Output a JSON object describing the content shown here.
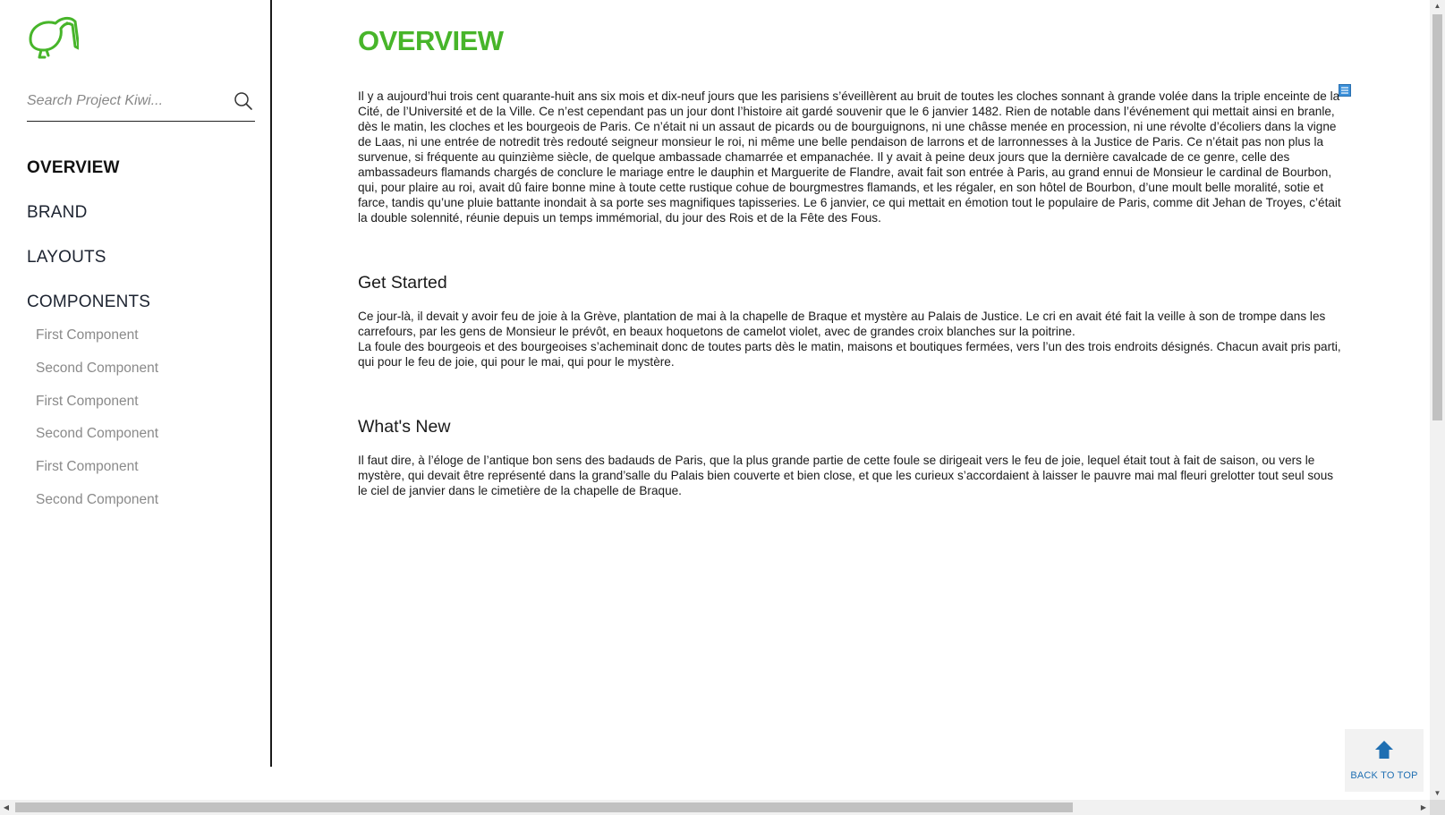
{
  "search": {
    "placeholder": "Search Project Kiwi..."
  },
  "nav": {
    "main": [
      {
        "label": "OVERVIEW",
        "active": true
      },
      {
        "label": "BRAND",
        "active": false
      },
      {
        "label": "LAYOUTS",
        "active": false
      },
      {
        "label": "COMPONENTS",
        "active": false
      }
    ],
    "sub": [
      {
        "label": "First Component"
      },
      {
        "label": "Second Component"
      },
      {
        "label": "First Component"
      },
      {
        "label": "Second Component"
      },
      {
        "label": "First Component"
      },
      {
        "label": "Second Component"
      }
    ]
  },
  "content": {
    "title": "OVERVIEW",
    "intro": "Il y a aujourd’hui trois cent quarante-huit ans six mois et dix-neuf jours que les parisiens s’éveillèrent au bruit de toutes les cloches sonnant à grande volée dans la triple enceinte de la Cité, de l’Université et de la Ville.  Ce n’est cependant pas un jour dont l’histoire ait gardé souvenir que le 6 janvier 1482. Rien de notable dans l’événement qui mettait ainsi en branle, dès le matin, les cloches et les bourgeois de Paris. Ce n’était ni un assaut de picards ou de bourguignons, ni une châsse menée en procession, ni une révolte d’écoliers dans la vigne de Laas, ni une entrée de notredit très redouté seigneur monsieur le roi, ni même une belle pendaison de larrons et de larronnesses à la Justice de Paris. Ce n’était pas non plus la survenue, si fréquente au quinzième siècle, de quelque ambassade chamarrée et empanachée. Il y avait à peine deux jours que la dernière cavalcade de ce genre, celle des ambassadeurs flamands chargés de conclure le mariage entre le dauphin et Marguerite de Flandre, avait fait son entrée à Paris, au grand ennui de Monsieur le cardinal de Bourbon, qui, pour plaire au roi, avait dû faire bonne mine à toute cette rustique cohue de bourgmestres flamands, et les régaler, en son hôtel de Bourbon, d’une moult belle moralité, sotie et farce, tandis qu’une pluie battante inondait à sa porte ses magnifiques tapisseries.  Le 6 janvier, ce qui mettait en émotion tout le populaire de Paris, comme dit Jehan de Troyes, c’était la double solennité, réunie depuis un temps immémorial, du jour des Rois et de la Fête des Fous.",
    "get_started": {
      "title": "Get Started",
      "body_1": "Ce jour-là, il devait y avoir feu de joie à la Grève, plantation de mai à la chapelle de Braque et mystère au Palais de Justice. Le cri en avait été fait la veille à son de trompe dans les carrefours, par les gens de Monsieur le prévôt, en beaux hoquetons de camelot violet, avec de grandes croix blanches sur la poitrine.",
      "body_2": "La foule des bourgeois et des bourgeoises s’acheminait donc de toutes parts dès le matin, maisons et boutiques fermées, vers l’un des trois endroits désignés. Chacun avait pris parti, qui pour le feu de joie, qui pour le mai, qui pour le mystère."
    },
    "whats_new": {
      "title": "What's New",
      "body": " Il faut dire, à l’éloge de l’antique bon sens des badauds de Paris, que la plus grande partie de cette foule se dirigeait vers le feu de joie, lequel était tout à fait de saison, ou vers le mystère, qui devait être représenté dans la grand’salle du Palais bien couverte et bien close, et que les curieux s’accordaient à laisser le pauvre mai mal fleuri grelotter tout seul sous le ciel de janvier dans le cimetière de la chapelle de Braque."
    }
  },
  "back_to_top": {
    "label": "BACK TO TOP"
  },
  "icons": {
    "logo": "kiwi-bird-icon",
    "search": "search-icon",
    "note": "note-icon",
    "back_to_top": "arrow-up-icon"
  },
  "colors": {
    "accent_green": "#47b52a",
    "link_blue": "#1f6fb2",
    "muted_text": "#8a8a8a"
  }
}
